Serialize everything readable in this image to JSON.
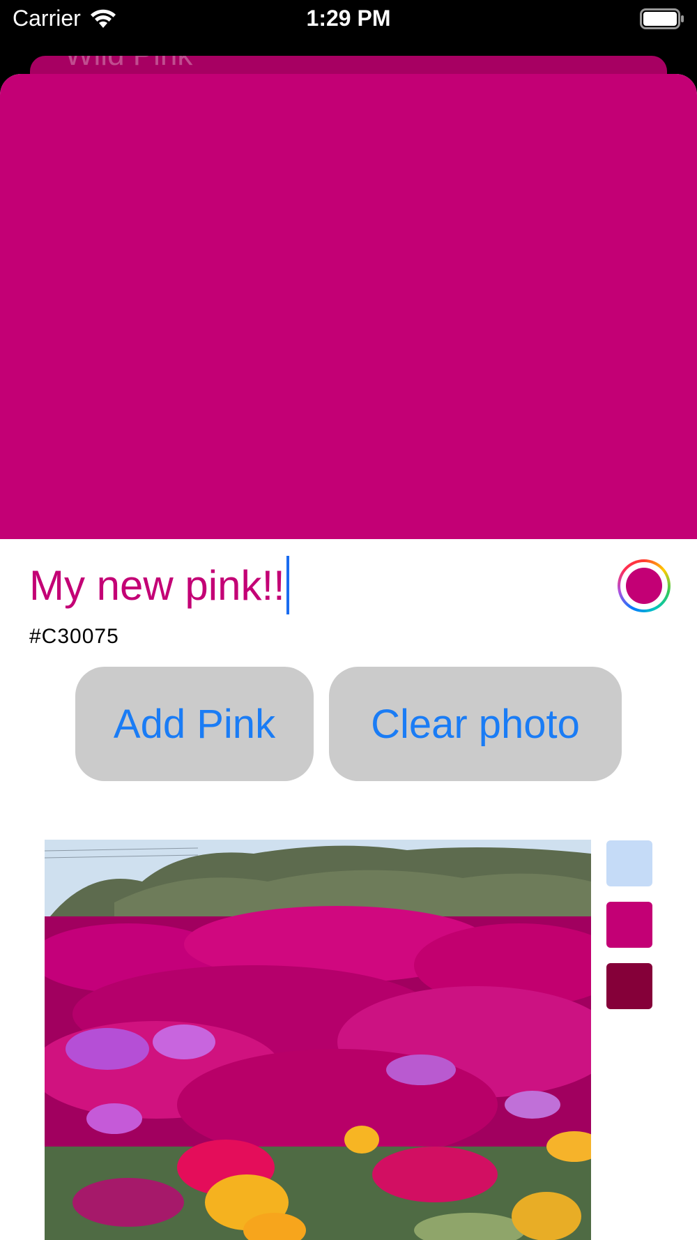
{
  "status_bar": {
    "carrier": "Carrier",
    "time": "1:29 PM",
    "icons": [
      "wifi-icon",
      "battery-icon"
    ]
  },
  "background_sheet": {
    "title": "Wild Pink"
  },
  "color": {
    "hex": "#C30075",
    "preview_color": "#C30075"
  },
  "editor": {
    "name_value": "My new pink!!",
    "hex_label": "#C30075"
  },
  "buttons": {
    "add_label": "Add Pink",
    "clear_label": "Clear photo"
  },
  "palette": {
    "swatches": [
      "#C5DBF7",
      "#C30075",
      "#850039"
    ]
  },
  "colors": {
    "button_text": "#1A7CF5",
    "button_bg": "#CBCBCB",
    "caret": "#1A6CF0"
  }
}
